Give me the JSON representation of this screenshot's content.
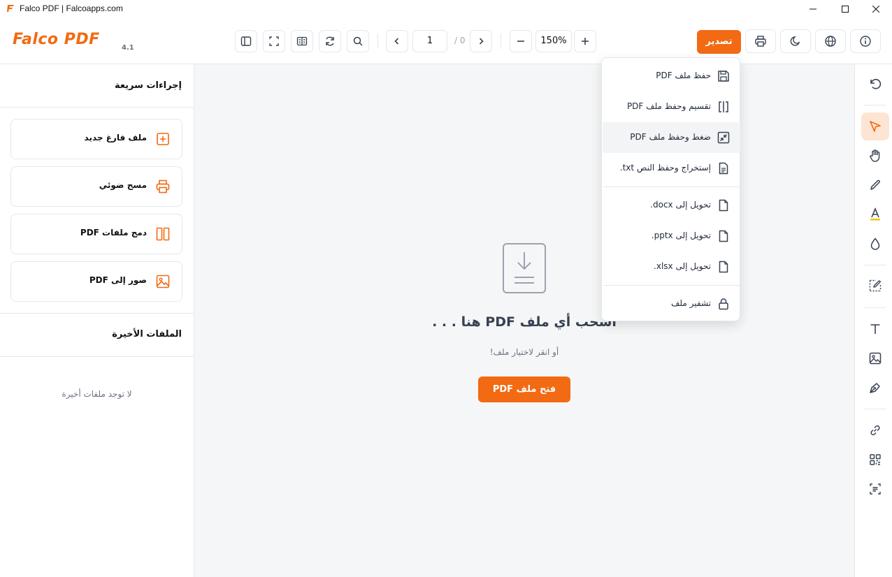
{
  "window": {
    "title": "Falco PDF | Falcoapps.com"
  },
  "toolbar": {
    "logo_text": "Falco PDF",
    "version": "4.1",
    "page_current": "1",
    "page_total": "/ 0",
    "zoom": "150%",
    "export_label": "تصدير"
  },
  "sidebar": {
    "quick_actions_title": "إجراءات سريعة",
    "actions": [
      {
        "label": "ملف فارغ جديد",
        "icon": "plus-square-icon"
      },
      {
        "label": "مسح ضوئي",
        "icon": "printer-icon"
      },
      {
        "label": "دمج ملفات PDF",
        "icon": "merge-columns-icon"
      },
      {
        "label": "صور إلى PDF",
        "icon": "image-icon"
      }
    ],
    "recent_title": "الملفات الأخيرة",
    "no_recent": "لا توجد ملفات أخيرة"
  },
  "main": {
    "drop_title": "اسحب أي ملف PDF هنا . . .",
    "drop_subtitle": "أو انقر لاختيار ملف!",
    "open_button": "فتح ملف PDF"
  },
  "export_menu": {
    "items": [
      {
        "label": "حفظ ملف PDF",
        "icon": "save-icon"
      },
      {
        "label": "تقسيم وحفظ ملف PDF",
        "icon": "split-icon"
      },
      {
        "label": "ضغط وحفظ ملف PDF",
        "icon": "compress-icon"
      },
      {
        "label": "إستخراج وحفظ النص txt.",
        "icon": "text-file-icon"
      },
      {
        "label": "تحويل إلى docx.",
        "icon": "file-icon"
      },
      {
        "label": "تحويل إلى pptx.",
        "icon": "file-icon"
      },
      {
        "label": "تحويل إلى xlsx.",
        "icon": "file-icon"
      },
      {
        "label": "تشفير ملف",
        "icon": "lock-icon"
      }
    ]
  },
  "colors": {
    "accent": "#f26a13",
    "accent_light": "#fde4d3",
    "canvas_bg": "#f5f6f7"
  }
}
